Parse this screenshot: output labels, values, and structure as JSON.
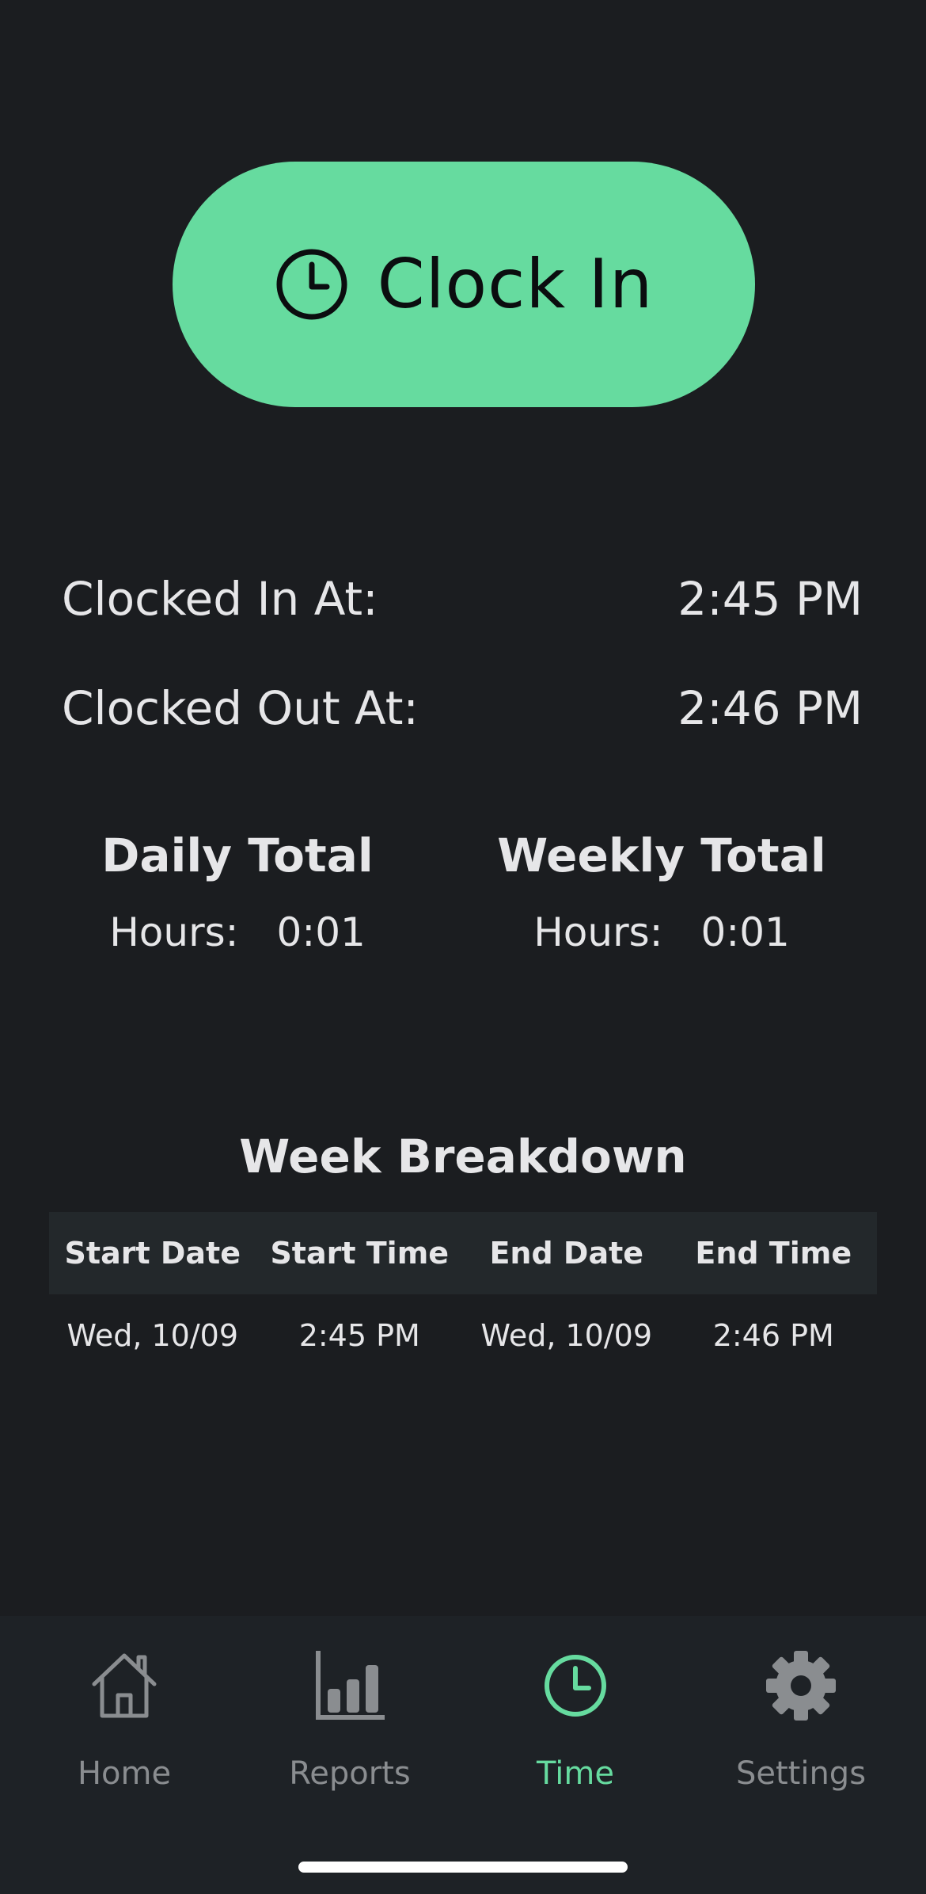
{
  "clock_button": {
    "label": "Clock In",
    "icon": "clock-icon",
    "color": "#66db9f"
  },
  "clocked_in": {
    "label": "Clocked In At:",
    "value": "2:45 PM"
  },
  "clocked_out": {
    "label": "Clocked Out At:",
    "value": "2:46 PM"
  },
  "daily_total": {
    "title": "Daily Total",
    "hours_label": "Hours:",
    "hours_value": "0:01"
  },
  "weekly_total": {
    "title": "Weekly Total",
    "hours_label": "Hours:",
    "hours_value": "0:01"
  },
  "week_breakdown": {
    "title": "Week Breakdown",
    "columns": [
      "Start Date",
      "Start Time",
      "End Date",
      "End Time"
    ],
    "rows": [
      [
        "Wed, 10/09",
        "2:45 PM",
        "Wed, 10/09",
        "2:46 PM"
      ]
    ]
  },
  "tabbar": {
    "active_color": "#66db9f",
    "inactive_color": "#8a8d90",
    "items": [
      {
        "label": "Home",
        "icon": "home-icon",
        "active": false
      },
      {
        "label": "Reports",
        "icon": "bar-chart-icon",
        "active": false
      },
      {
        "label": "Time",
        "icon": "clock-icon",
        "active": true
      },
      {
        "label": "Settings",
        "icon": "gear-icon",
        "active": false
      }
    ]
  }
}
